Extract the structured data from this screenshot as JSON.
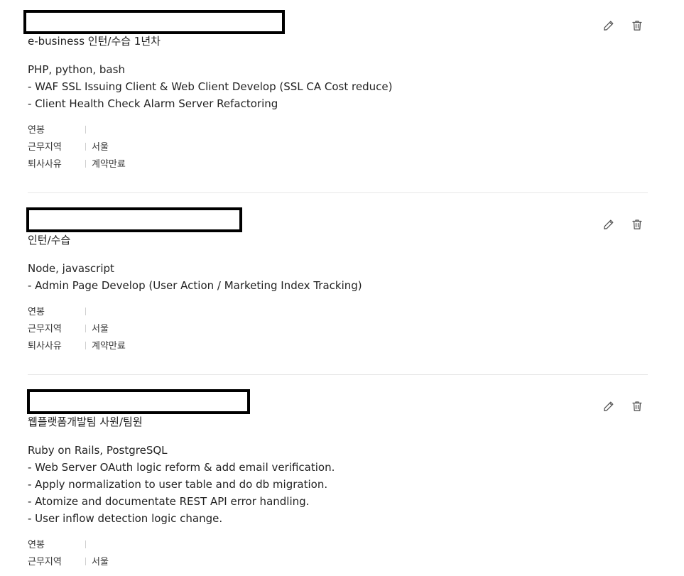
{
  "entries": [
    {
      "role": "e-business 인턴/수습 1년차",
      "description": [
        "PHP, python, bash",
        "- WAF SSL Issuing Client & Web Client Develop (SSL CA Cost reduce)",
        "- Client Health Check Alarm Server Refactoring"
      ],
      "meta": [
        {
          "key": "연봉",
          "value": ""
        },
        {
          "key": "근무지역",
          "value": "서울"
        },
        {
          "key": "퇴사사유",
          "value": "계약만료"
        }
      ]
    },
    {
      "role": "인턴/수습",
      "description": [
        "Node, javascript",
        "- Admin Page Develop (User Action / Marketing Index Tracking)"
      ],
      "meta": [
        {
          "key": "연봉",
          "value": ""
        },
        {
          "key": "근무지역",
          "value": "서울"
        },
        {
          "key": "퇴사사유",
          "value": "계약만료"
        }
      ]
    },
    {
      "role": "웹플랫폼개발팀 사원/팀원",
      "description": [
        "Ruby on Rails, PostgreSQL",
        "- Web Server OAuth logic reform & add email verification.",
        "- Apply normalization to user table and do db migration.",
        "- Atomize and documentate REST API error handling.",
        "- User inflow detection logic change."
      ],
      "meta": [
        {
          "key": "연봉",
          "value": ""
        },
        {
          "key": "근무지역",
          "value": "서울"
        }
      ]
    }
  ],
  "icons": {
    "edit": "pencil-icon",
    "delete": "trash-icon"
  },
  "colors": {
    "text": "#222222",
    "divider": "#e6e6e6",
    "icon": "#555555"
  }
}
